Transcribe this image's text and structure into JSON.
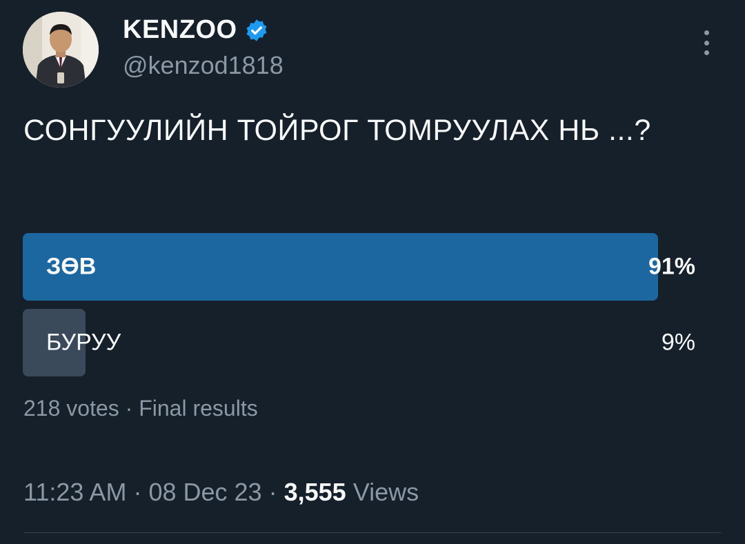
{
  "author": {
    "display_name": "KENZOO",
    "handle": "@kenzod1818",
    "verified": true,
    "avatar_icon": "profile-photo"
  },
  "more_icon": "more-vertical-icon",
  "tweet": {
    "text": "СОНГУУЛИЙН ТОЙРОГ ТОМРУУЛАХ НЬ ...?"
  },
  "poll": {
    "options": [
      {
        "label": "ЗӨВ",
        "percent_text": "91%",
        "percent": 91,
        "winner": true
      },
      {
        "label": "БУРУУ",
        "percent_text": "9%",
        "percent": 9,
        "winner": false
      }
    ],
    "votes_text": "218 votes",
    "separator": "·",
    "status_text": "Final results"
  },
  "meta": {
    "time": "11:23 AM",
    "separator": "·",
    "date": "08 Dec 23",
    "views_count": "3,555",
    "views_label": "Views"
  },
  "colors": {
    "background": "#15202b",
    "winner_bar": "#1c679f",
    "other_bar": "#3a4a5a",
    "secondary_text": "#8b98a5",
    "verified": "#1d9bf0"
  }
}
